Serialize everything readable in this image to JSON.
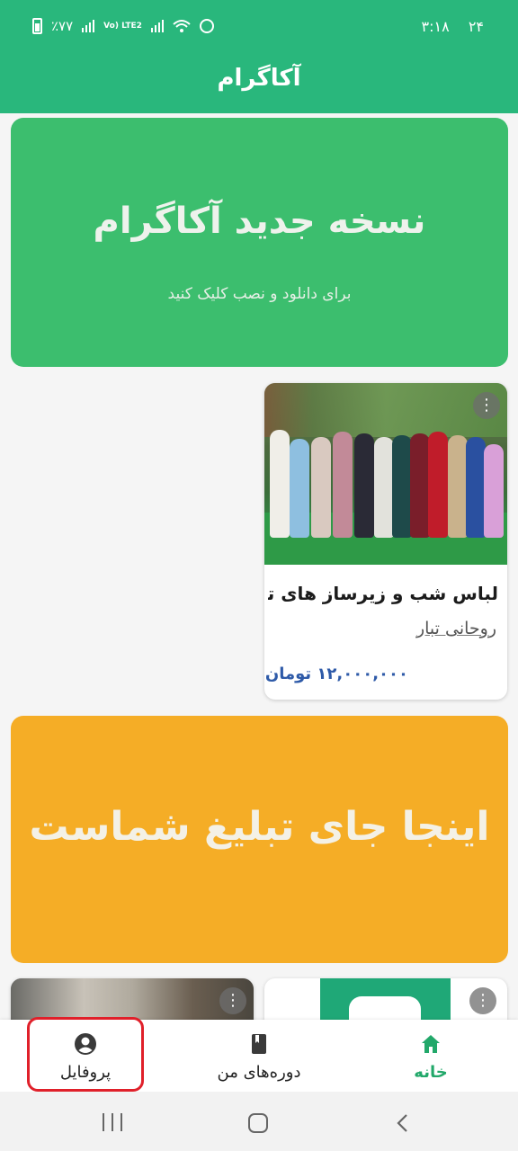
{
  "status_bar": {
    "time": "۳:۱۸",
    "date": "۲۴",
    "battery": "٪۷۷",
    "network": "Vo) LTE2"
  },
  "app_bar": {
    "title": "آکاگرام"
  },
  "banner_update": {
    "title": "نسخه جدید آکاگرام",
    "subtitle": "برای دانلود و نصب کلیک کنید",
    "color": "#3cbe6e"
  },
  "product_card": {
    "title": "لباس شب و زیرساز های تخ",
    "seller": "روحانی تبار",
    "price": "۱۲,۰۰۰,۰۰۰ تومان",
    "menu_icon": "more-vertical-icon"
  },
  "banner_ad": {
    "title": "اینجا جای تبلیغ شماست",
    "color": "#f5ad26"
  },
  "bottom_nav": {
    "items": [
      {
        "label": "خانه",
        "icon": "home-icon",
        "active": true
      },
      {
        "label": "دوره‌های من",
        "icon": "book-icon",
        "active": false
      },
      {
        "label": "پروفایل",
        "icon": "user-circle-icon",
        "active": false
      }
    ],
    "accent": "#22a86a"
  },
  "system_nav": {
    "recents_icon": "recents-icon",
    "home_icon": "home-button-icon",
    "back_icon": "back-icon"
  }
}
